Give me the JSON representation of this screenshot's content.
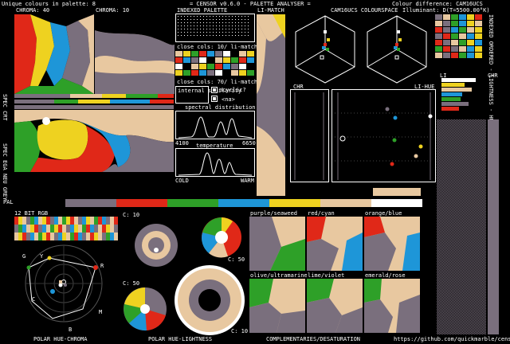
{
  "header": {
    "unique_colours": "Unique colours in palette: 8",
    "app_title": "= CENSOR v0.6.0 - PALETTE ANALYSER =",
    "colour_difference": "Colour difference: CAM16UCS",
    "illuminant": "Illuminant: D(T=5500.00°K)"
  },
  "labels": {
    "chroma_40": "CHROMA: 40",
    "chroma_10": "CHROMA: 10",
    "indexed_palette": "INDEXED PALETTE",
    "li_match": "LI-MATCH",
    "cam16ucs_space": "CAM16UCS COLOURSPACE",
    "spec_crt": "SPEC CRT",
    "spec_ega": "SPEC EGA",
    "neu_grey": "NEU GREY",
    "pal": "PAL",
    "close_cols_1": "close cols: 10/ li-match",
    "close_cols_2": "close cols: 70/ li-match",
    "internal_similarity": "internal similarity",
    "cyclic": "acyclic?",
    "na": "<na>",
    "spectral_distribution": "spectral distribution",
    "spec_min": "4100",
    "spec_max": "6650",
    "temperature": "temperature",
    "cold": "COLD",
    "warm": "WARM",
    "chr": "CHR",
    "li_hue": "LI-HUE",
    "li": "LI",
    "chr2": "CHR",
    "ordered_lightness": "INDEXED ORDERED - LIGHTNESS - HUE & CHROMA",
    "bit12_rgb": "12 BIT RGB",
    "c10": "C: 10",
    "c50a": "C: 50",
    "c50b": "C: 50",
    "c10b": "C: 10",
    "polar_hue_chroma": "POLAR HUE-CHROMA",
    "polar_hue_lightness": "POLAR HUE-LIGHTNESS",
    "complementaries": "COMPLEMENTARIES/DESATURATION",
    "github": "https://github.com/quickmarble/censor"
  },
  "wheel_letters": {
    "g": "G",
    "y": "Y",
    "r": "R",
    "c": "C",
    "m": "M",
    "b": "B"
  },
  "complement_titles": [
    "purple/seaweed",
    "red/cyan",
    "orange/blue",
    "olive/ultramarine",
    "lime/violet",
    "emerald/rose"
  ],
  "palette": [
    "#000000",
    "#7a6f7d",
    "#e02818",
    "#2ea028",
    "#1e96d8",
    "#eed220",
    "#e8c8a0",
    "#ffffff"
  ],
  "status": {
    "internal_checked": true,
    "cyclic_checked": true
  }
}
